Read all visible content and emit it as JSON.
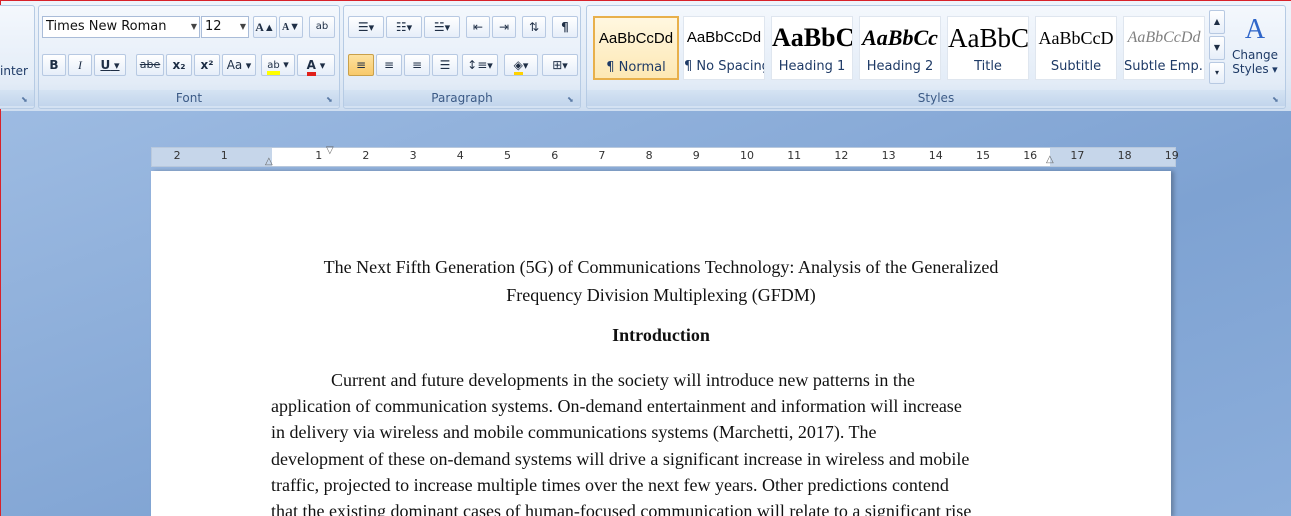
{
  "clipboard": {
    "painter_label": "inter"
  },
  "font": {
    "name": "Times New Roman",
    "size": "12",
    "grow_label": "A",
    "shrink_label": "A",
    "clear_label": "ab",
    "bold_label": "B",
    "italic_label": "I",
    "underline_label": "U",
    "strike_label": "abe",
    "sub_label": "x₂",
    "sup_label": "x²",
    "case_label": "Aa",
    "highlight_label": "ab",
    "color_label": "A",
    "group_label": "Font"
  },
  "paragraph": {
    "group_label": "Paragraph",
    "pilcrow": "¶"
  },
  "styles": {
    "group_label": "Styles",
    "items": [
      {
        "preview": "AaBbCcDd",
        "name": "¶ Normal"
      },
      {
        "preview": "AaBbCcDd",
        "name": "¶ No Spacing"
      },
      {
        "preview": "AaBbC",
        "name": "Heading 1"
      },
      {
        "preview": "AaBbCc",
        "name": "Heading 2"
      },
      {
        "preview": "AaBbC",
        "name": "Title"
      },
      {
        "preview": "AaBbCcD",
        "name": "Subtitle"
      },
      {
        "preview": "AaBbCcDd",
        "name": "Subtle Emp..."
      }
    ],
    "change_label_1": "Change",
    "change_label_2": "Styles"
  },
  "ruler": {
    "numbers": [
      "2",
      "1",
      "1",
      "2",
      "3",
      "4",
      "5",
      "6",
      "7",
      "8",
      "9",
      "10",
      "11",
      "12",
      "13",
      "14",
      "15",
      "16",
      "17",
      "18",
      "19"
    ]
  },
  "document": {
    "title_line1": "The Next Fifth Generation (5G) of Communications Technology: Analysis of the Generalized",
    "title_line2": "Frequency Division Multiplexing (GFDM)",
    "heading": "Introduction",
    "lines": [
      "Current and future developments in the society will introduce new patterns in the",
      "application of communication systems. On-demand entertainment and information will increase",
      "in delivery via wireless and mobile communications systems (Marchetti, 2017). The",
      "development of these on-demand systems will drive a significant increase in wireless and mobile",
      "traffic, projected to increase multiple times over the next few years. Other predictions contend",
      "that the existing dominant cases of human-focused communication will relate to a significant rise"
    ]
  }
}
